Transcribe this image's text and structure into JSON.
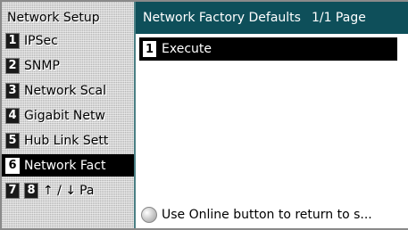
{
  "left_menu": {
    "title": "Network Setup",
    "items": [
      {
        "number": "1",
        "label": "IPSec"
      },
      {
        "number": "2",
        "label": "SNMP"
      },
      {
        "number": "3",
        "label": "Network Scal"
      },
      {
        "number": "4",
        "label": "Gigabit Netw"
      },
      {
        "number": "5",
        "label": "Hub Link Sett"
      },
      {
        "number": "6",
        "label": "Network Fact",
        "selected": true
      }
    ],
    "nav_row": {
      "num_a": "7",
      "num_b": "8",
      "arrows": "↑ / ↓",
      "label": "Pa"
    }
  },
  "right_panel": {
    "title": "Network Factory Defaults",
    "page_info": "1/1 Page",
    "items": [
      {
        "number": "1",
        "label": "Execute"
      }
    ],
    "hint": {
      "icon": "online-button-icon",
      "text": "Use Online button to return to s..."
    }
  },
  "colors": {
    "title_bar": "#0e4f5a",
    "selected_bg": "#000000",
    "menu_bg": "#d6d6d6"
  }
}
